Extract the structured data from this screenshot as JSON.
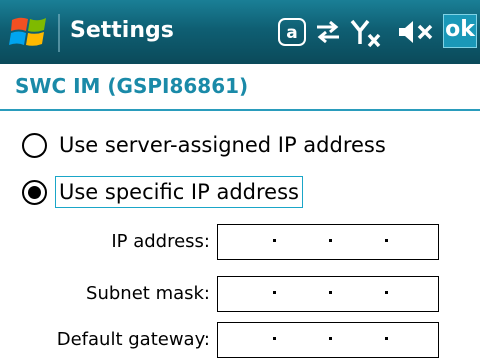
{
  "header": {
    "title": "Settings",
    "ok_label": "ok",
    "icons": [
      "windows-start-icon",
      "at-icon",
      "connectivity-icon",
      "no-signal-icon",
      "speaker-muted-icon"
    ]
  },
  "page": {
    "title": "SWC IM (GSPI86861)"
  },
  "options": [
    {
      "label": "Use server-assigned IP address",
      "selected": false
    },
    {
      "label": "Use specific IP address",
      "selected": true
    }
  ],
  "fields": [
    {
      "label": "IP address:",
      "separator": "."
    },
    {
      "label": "Subnet mask:",
      "separator": "."
    },
    {
      "label": "Default gateway:",
      "separator": "."
    }
  ],
  "colors": {
    "titlebar": "#0f5f73",
    "accent": "#1a8aa8",
    "focus": "#1aa6c8"
  }
}
